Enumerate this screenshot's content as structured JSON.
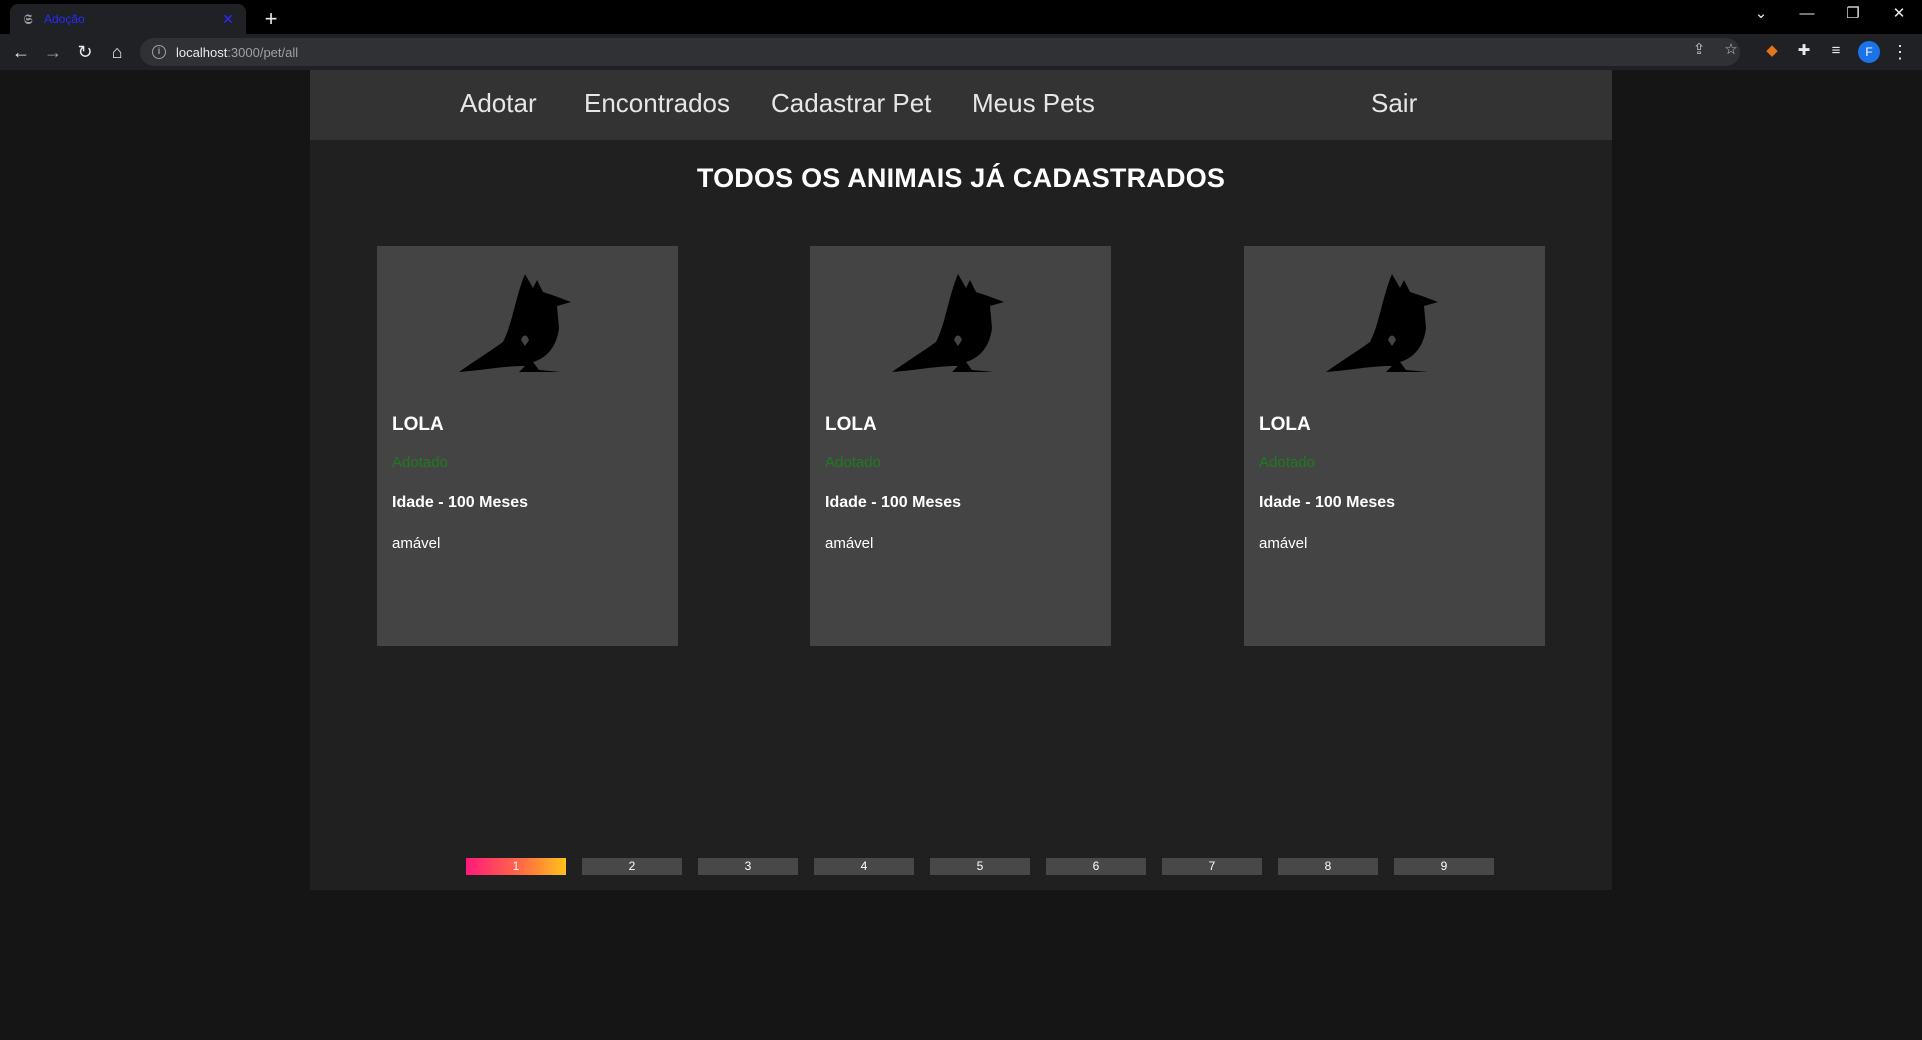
{
  "browser": {
    "tab_title": "Adoção",
    "url_host": "localhost",
    "url_path": ":3000/pet/all",
    "profile_initial": "F"
  },
  "nav": {
    "links": [
      "Adotar",
      "Encontrados",
      "Cadastrar Pet",
      "Meus Pets"
    ],
    "logout": "Sair"
  },
  "title": "TODOS OS ANIMAIS JÁ CADASTRADOS",
  "pets": [
    {
      "name": "LOLA",
      "status": "Adotado",
      "age": "Idade - 100 Meses",
      "description": "amável",
      "image_icon": "bird-icon"
    },
    {
      "name": "LOLA",
      "status": "Adotado",
      "age": "Idade - 100 Meses",
      "description": "amável",
      "image_icon": "bird-icon"
    },
    {
      "name": "LOLA",
      "status": "Adotado",
      "age": "Idade - 100 Meses",
      "description": "amável",
      "image_icon": "bird-icon"
    }
  ],
  "pagination": {
    "pages": [
      "1",
      "2",
      "3",
      "4",
      "5",
      "6",
      "7",
      "8",
      "9"
    ],
    "current": "1"
  },
  "colors": {
    "page_bg": "#202020",
    "nav_bg": "#333333",
    "card_bg": "#454445",
    "status_green": "#1f7a1f",
    "active_gradient": [
      "#ff1a7a",
      "#ffc21a"
    ]
  }
}
